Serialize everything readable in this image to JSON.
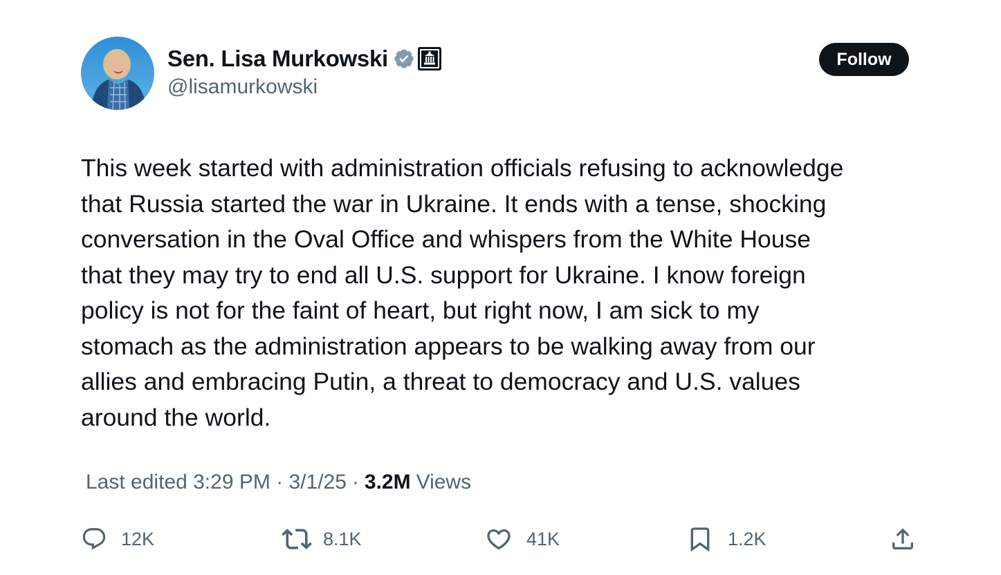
{
  "author": {
    "display_name": "Sen. Lisa Murkowski",
    "handle": "@lisamurkowski",
    "verified_badge_color": "#829aab",
    "affiliation_badge": "government-building-icon"
  },
  "follow_button": {
    "label": "Follow"
  },
  "tweet": {
    "lines": [
      "This week started with administration officials refusing to acknowledge",
      "that Russia started the war in Ukraine. It ends with a tense, shocking",
      "conversation in the Oval Office and whispers from the White House",
      "that they may try to end all U.S. support for Ukraine. I know foreign",
      "policy is not for the faint of heart, but right now, I am sick to my",
      "stomach as the administration appears to be walking away from our",
      "allies and embracing Putin, a threat to democracy and U.S. values",
      "around the world."
    ]
  },
  "meta": {
    "edited_label": "Last edited 3:29 PM · 3/1/25",
    "separator": "·",
    "views_count": "3.2M",
    "views_label": "Views"
  },
  "actions": {
    "reply_count": "12K",
    "retweet_count": "8.1K",
    "like_count": "41K",
    "bookmark_count": "1.2K"
  },
  "colors": {
    "text_primary": "#0f1419",
    "text_secondary": "#536471",
    "button_bg": "#0f1419"
  }
}
